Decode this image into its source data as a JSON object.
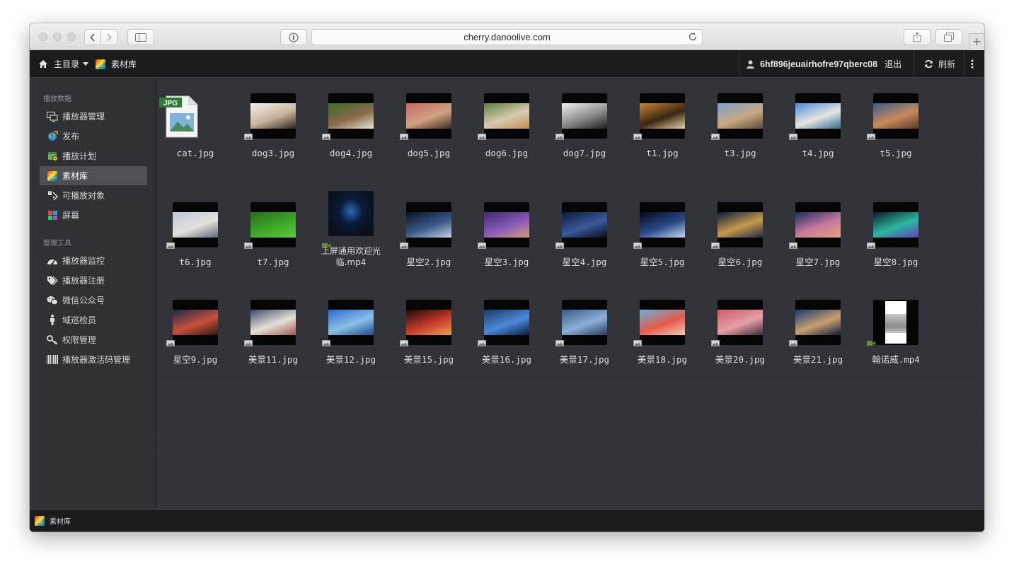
{
  "browser": {
    "url": "cherry.danoolive.com"
  },
  "header": {
    "home_label": "主目录",
    "breadcrumb_current": "素材库",
    "username": "6hf896jeuairhofre97qberc08",
    "logout_label": "退出",
    "refresh_label": "刷新"
  },
  "sidebar": {
    "section1_title": "播放数据",
    "section1_items": [
      {
        "label": "播放器管理",
        "icon": "player-manage-icon"
      },
      {
        "label": "发布",
        "icon": "publish-globe-icon"
      },
      {
        "label": "播放计划",
        "icon": "schedule-icon"
      },
      {
        "label": "素材库",
        "icon": "media-library-icon",
        "active": true
      },
      {
        "label": "可播放对象",
        "icon": "playable-object-icon"
      },
      {
        "label": "屏幕",
        "icon": "screen-icon"
      }
    ],
    "section2_title": "管理工具",
    "section2_items": [
      {
        "label": "播放器监控",
        "icon": "dashboard-icon"
      },
      {
        "label": "播放器注册",
        "icon": "tags-icon"
      },
      {
        "label": "微信公众号",
        "icon": "wechat-icon"
      },
      {
        "label": "域巡检员",
        "icon": "person-icon"
      },
      {
        "label": "权限管理",
        "icon": "key-icon"
      },
      {
        "label": "播放器激活码管理",
        "icon": "barcode-icon"
      }
    ]
  },
  "files": [
    {
      "name": "cat.jpg",
      "type": "jpg-doc"
    },
    {
      "name": "dog3.jpg",
      "type": "image",
      "colors": [
        "#f4f2ee",
        "#c8b39a",
        "#2a2420"
      ]
    },
    {
      "name": "dog4.jpg",
      "type": "image",
      "colors": [
        "#3c6b2a",
        "#8a6a4a",
        "#e8e2d6"
      ]
    },
    {
      "name": "dog5.jpg",
      "type": "image",
      "colors": [
        "#c46b62",
        "#d1a27f",
        "#3a2a22"
      ]
    },
    {
      "name": "dog6.jpg",
      "type": "image",
      "colors": [
        "#5d7d3a",
        "#d8cbb4",
        "#c28d4d"
      ]
    },
    {
      "name": "dog7.jpg",
      "type": "image",
      "colors": [
        "#f2f2f2",
        "#8a8a8a",
        "#1e1e1e"
      ]
    },
    {
      "name": "t1.jpg",
      "type": "image",
      "colors": [
        "#c9853b",
        "#3a2611",
        "#e8d2a8"
      ]
    },
    {
      "name": "t3.jpg",
      "type": "image",
      "colors": [
        "#7aa0c8",
        "#c9a982",
        "#5c4a3a"
      ]
    },
    {
      "name": "t4.jpg",
      "type": "image",
      "colors": [
        "#4b8bd6",
        "#e6e6e2",
        "#2e6d8e"
      ]
    },
    {
      "name": "t5.jpg",
      "type": "image",
      "colors": [
        "#3a5a8a",
        "#c98a5a",
        "#5a3a2a"
      ]
    },
    {
      "name": "t6.jpg",
      "type": "image",
      "colors": [
        "#b8c8d8",
        "#e6e0dc",
        "#5a6a7a"
      ]
    },
    {
      "name": "t7.jpg",
      "type": "image",
      "colors": [
        "#2a6b1a",
        "#3ea82a",
        "#5acd3a"
      ]
    },
    {
      "name": "上屏通用欢迎光临.mp4",
      "type": "video",
      "colors": [
        "#0a1c3a",
        "#2a6ab8",
        "#0a0f1a"
      ]
    },
    {
      "name": "星空2.jpg",
      "type": "image",
      "colors": [
        "#0a1020",
        "#3a5a8a",
        "#c8d0e0"
      ]
    },
    {
      "name": "星空3.jpg",
      "type": "image",
      "colors": [
        "#3a2a6a",
        "#8a5ab8",
        "#d0a070"
      ]
    },
    {
      "name": "星空4.jpg",
      "type": "image",
      "colors": [
        "#0a1a3a",
        "#3a5a9a",
        "#0a0a1a"
      ]
    },
    {
      "name": "星空5.jpg",
      "type": "image",
      "colors": [
        "#050a1a",
        "#2a4a8a",
        "#c8d8f0"
      ]
    },
    {
      "name": "星空6.jpg",
      "type": "image",
      "colors": [
        "#0a1a3a",
        "#c89a4a",
        "#1a2a4a"
      ]
    },
    {
      "name": "星空7.jpg",
      "type": "image",
      "colors": [
        "#1a2a5a",
        "#c87aa0",
        "#e6a070"
      ]
    },
    {
      "name": "星空8.jpg",
      "type": "image",
      "colors": [
        "#0a1a2a",
        "#2ab8a0",
        "#6a3ab8"
      ]
    },
    {
      "name": "星空9.jpg",
      "type": "image",
      "colors": [
        "#1a2a4a",
        "#c8503a",
        "#2a1a10"
      ]
    },
    {
      "name": "美景11.jpg",
      "type": "image",
      "colors": [
        "#3a4a6a",
        "#e6e0d8",
        "#a05a4a"
      ]
    },
    {
      "name": "美景12.jpg",
      "type": "image",
      "colors": [
        "#2a6ac8",
        "#8ac0e8",
        "#1a4a8a"
      ]
    },
    {
      "name": "美景15.jpg",
      "type": "image",
      "colors": [
        "#1a0a0a",
        "#c83a2a",
        "#e6a050"
      ]
    },
    {
      "name": "美景16.jpg",
      "type": "image",
      "colors": [
        "#1a3a6a",
        "#4a8ad8",
        "#0a1a3a"
      ]
    },
    {
      "name": "美景17.jpg",
      "type": "image",
      "colors": [
        "#3a5a8a",
        "#8ab0d8",
        "#2a3a5a"
      ]
    },
    {
      "name": "美景18.jpg",
      "type": "image",
      "colors": [
        "#6ab0d8",
        "#e65a4a",
        "#f0c8b8"
      ]
    },
    {
      "name": "美景20.jpg",
      "type": "image",
      "colors": [
        "#c85a6a",
        "#e6a0a8",
        "#3a2a3a"
      ]
    },
    {
      "name": "美景21.jpg",
      "type": "image",
      "colors": [
        "#1a3a6a",
        "#c8a070",
        "#0a1a3a"
      ]
    },
    {
      "name": "翰诺威.mp4",
      "type": "video-portrait",
      "colors": [
        "#ffffff",
        "#8a8a8a",
        "#c8c8c8"
      ]
    }
  ],
  "statusbar": {
    "label": "素材库"
  },
  "colors": {
    "header_bg": "#1b1c1e",
    "sidebar_bg": "#2f3134",
    "content_bg": "#313338",
    "active_item_bg": "#4d5055",
    "video_badge": "#6a8a3a"
  }
}
